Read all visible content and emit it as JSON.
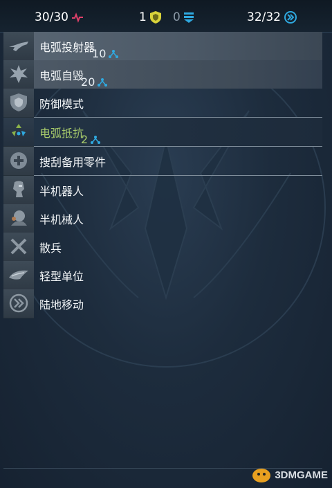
{
  "status": {
    "health": "30/30",
    "shield": "1",
    "armor": "0",
    "move": "32/32"
  },
  "colors": {
    "accent_cyan": "#2fa9e0",
    "selected_green": "#a6c96a",
    "health_pink": "#e0406a",
    "shield_yellow": "#d8d23a"
  },
  "abilities": [
    {
      "label": "电弧投射器",
      "cost": "10",
      "icon": "arc-projector-icon"
    },
    {
      "label": "电弧自毁",
      "cost": "20",
      "icon": "self-destruct-icon"
    },
    {
      "label": "防御模式",
      "cost": "",
      "icon": "defense-mode-icon"
    },
    {
      "label": "电弧抵抗",
      "cost": "2",
      "icon": "arc-resistance-icon",
      "selected": true
    },
    {
      "label": "搜刮备用零件",
      "cost": "",
      "icon": "scavenge-parts-icon"
    },
    {
      "label": "半机器人",
      "cost": "",
      "icon": "cyborg-icon"
    },
    {
      "label": "半机械人",
      "cost": "",
      "icon": "android-icon"
    },
    {
      "label": "散兵",
      "cost": "",
      "icon": "skirmisher-icon"
    },
    {
      "label": "轻型单位",
      "cost": "",
      "icon": "light-unit-icon"
    },
    {
      "label": "陆地移动",
      "cost": "",
      "icon": "land-movement-icon"
    }
  ],
  "watermark": "3DMGAME"
}
